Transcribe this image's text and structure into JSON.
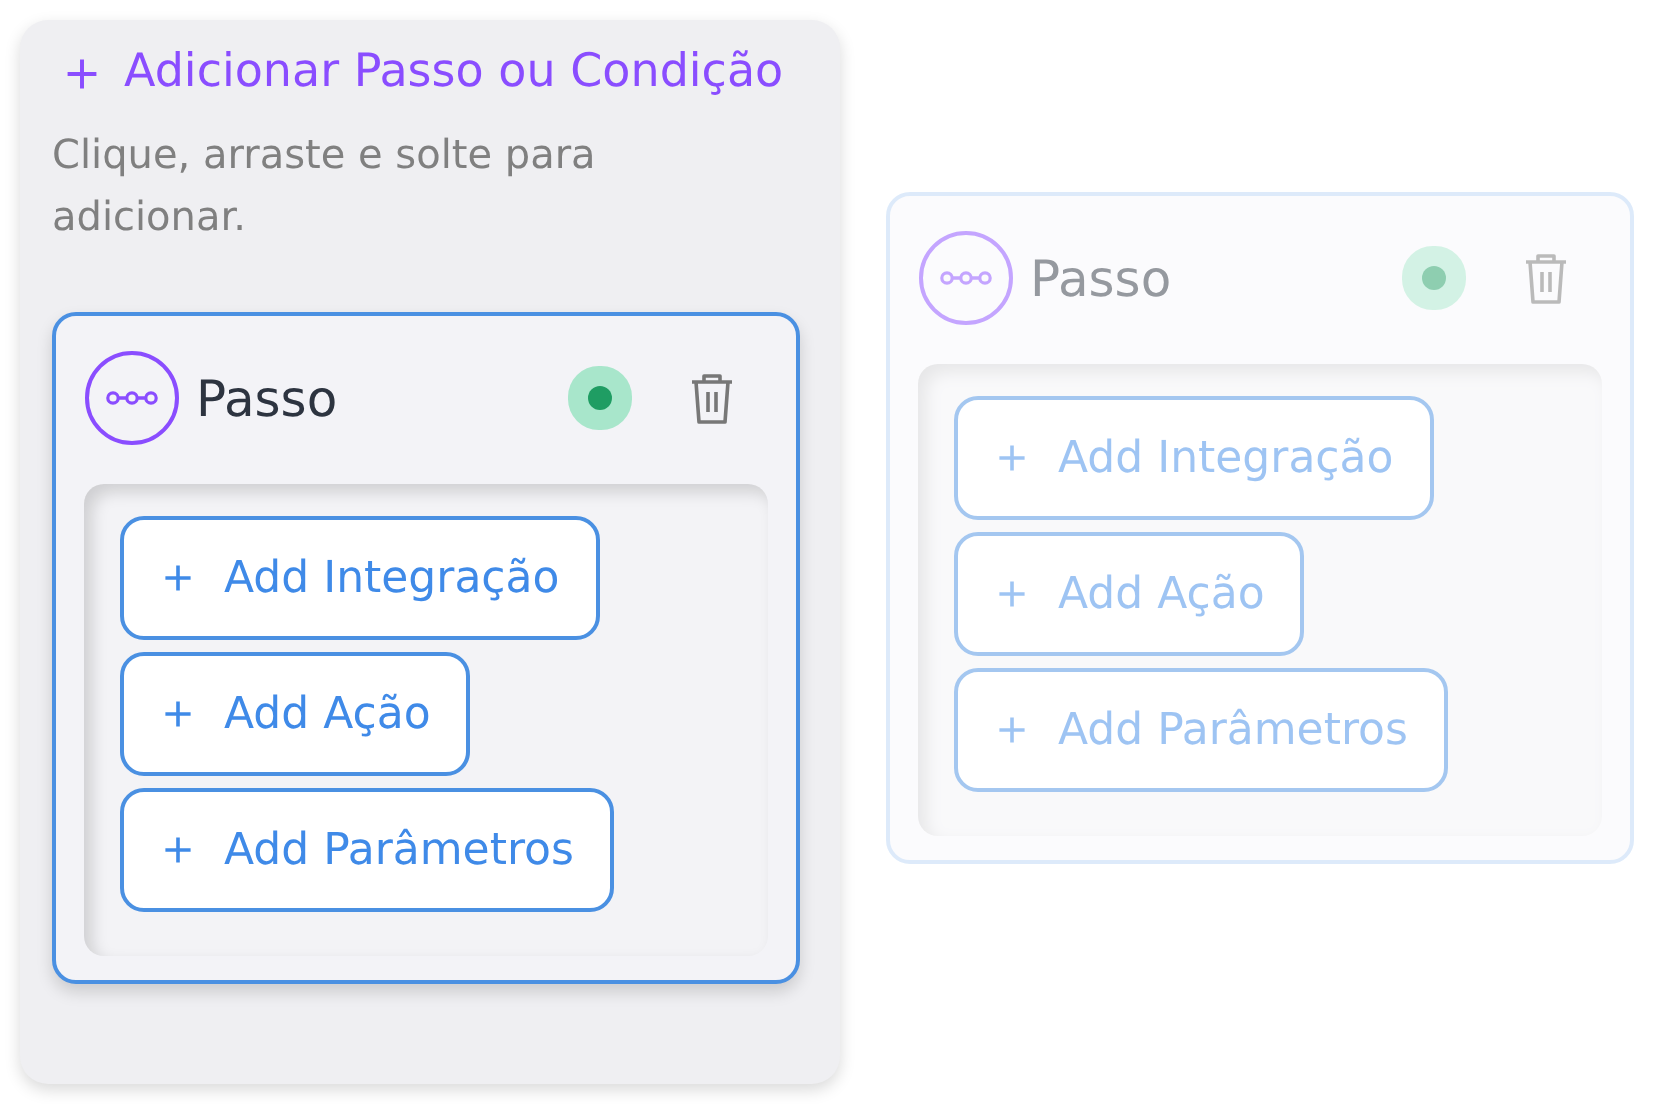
{
  "panel": {
    "title": "Adicionar Passo ou Condição",
    "subtitle": "Clique, arraste e solte para adicionar."
  },
  "cards": [
    {
      "title": "Passo",
      "ghost": false,
      "buttons": [
        "Add Integração",
        "Add Ação",
        "Add Parâmetros"
      ]
    },
    {
      "title": "Passo",
      "ghost": true,
      "buttons": [
        "Add Integração",
        "Add Ação",
        "Add Parâmetros"
      ]
    }
  ]
}
